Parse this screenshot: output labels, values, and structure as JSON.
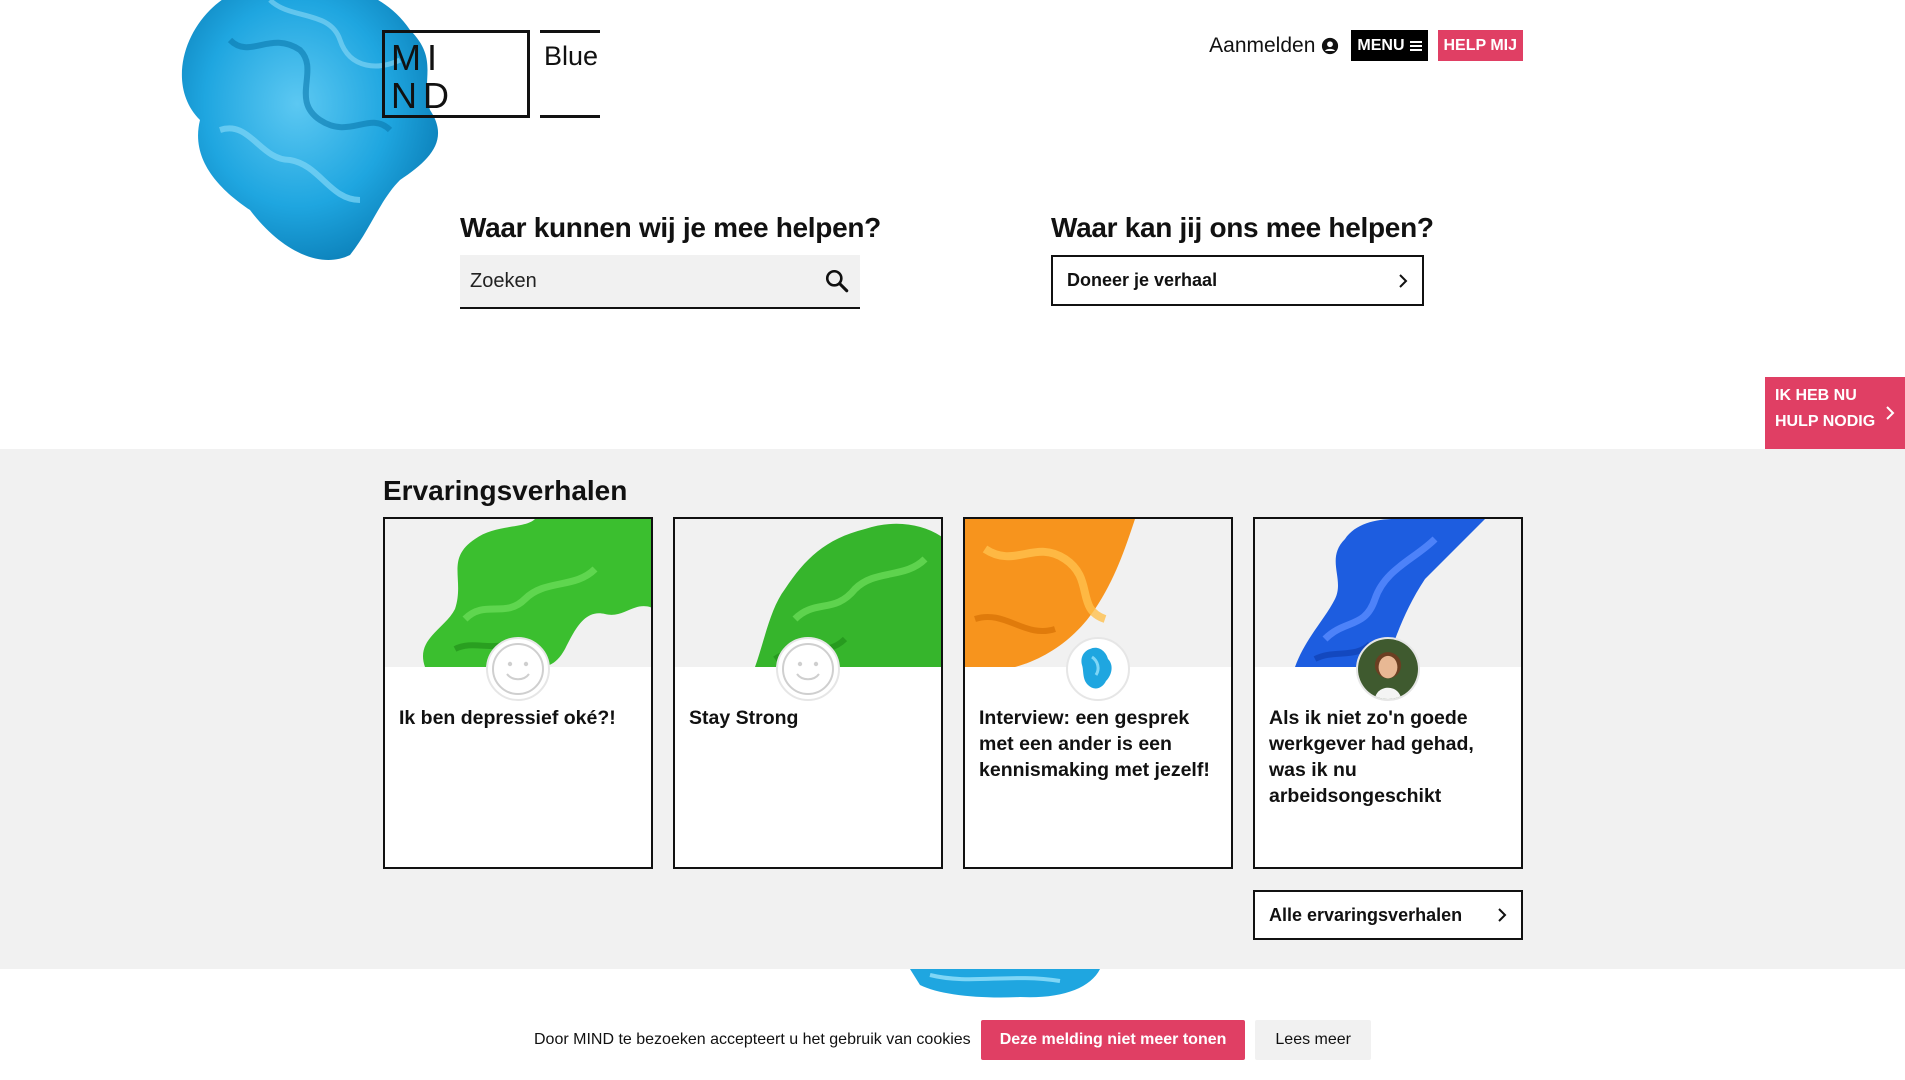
{
  "brand": {
    "logo_mind": "MI\nND",
    "logo_blue": "Blue",
    "accent": "#e03f64",
    "ink_blue": "#1fa6e0"
  },
  "topnav": {
    "login": "Aanmelden",
    "menu": "MENU",
    "help": "HELP MIJ"
  },
  "help_left": {
    "heading": "Waar kunnen wij je mee helpen?",
    "search_placeholder": "Zoeken"
  },
  "help_right": {
    "heading": "Waar kan jij ons mee helpen?",
    "donate": "Doneer je verhaal"
  },
  "urgent": {
    "line1": "IK HEB NU",
    "line2": "HULP NODIG"
  },
  "stories": {
    "title": "Ervaringsverhalen",
    "cards": [
      {
        "title": "Ik ben depressief oké?!",
        "ink": "green",
        "avatar": "smiley"
      },
      {
        "title": "Stay Strong",
        "ink": "green",
        "avatar": "smiley"
      },
      {
        "title": "Interview: een gesprek met een ander is een kennismaking met jezelf!",
        "ink": "orange",
        "avatar": "blue-ink"
      },
      {
        "title": "Als ik niet zo'n goede werkgever had gehad, was ik nu arbeidsongeschikt",
        "ink": "blue",
        "avatar": "photo"
      }
    ],
    "all_button": "Alle ervaringsverhalen"
  },
  "cookie": {
    "text": "Door MIND te bezoeken accepteert u het gebruik van cookies",
    "accept": "Deze melding niet meer tonen",
    "more": "Lees meer"
  }
}
